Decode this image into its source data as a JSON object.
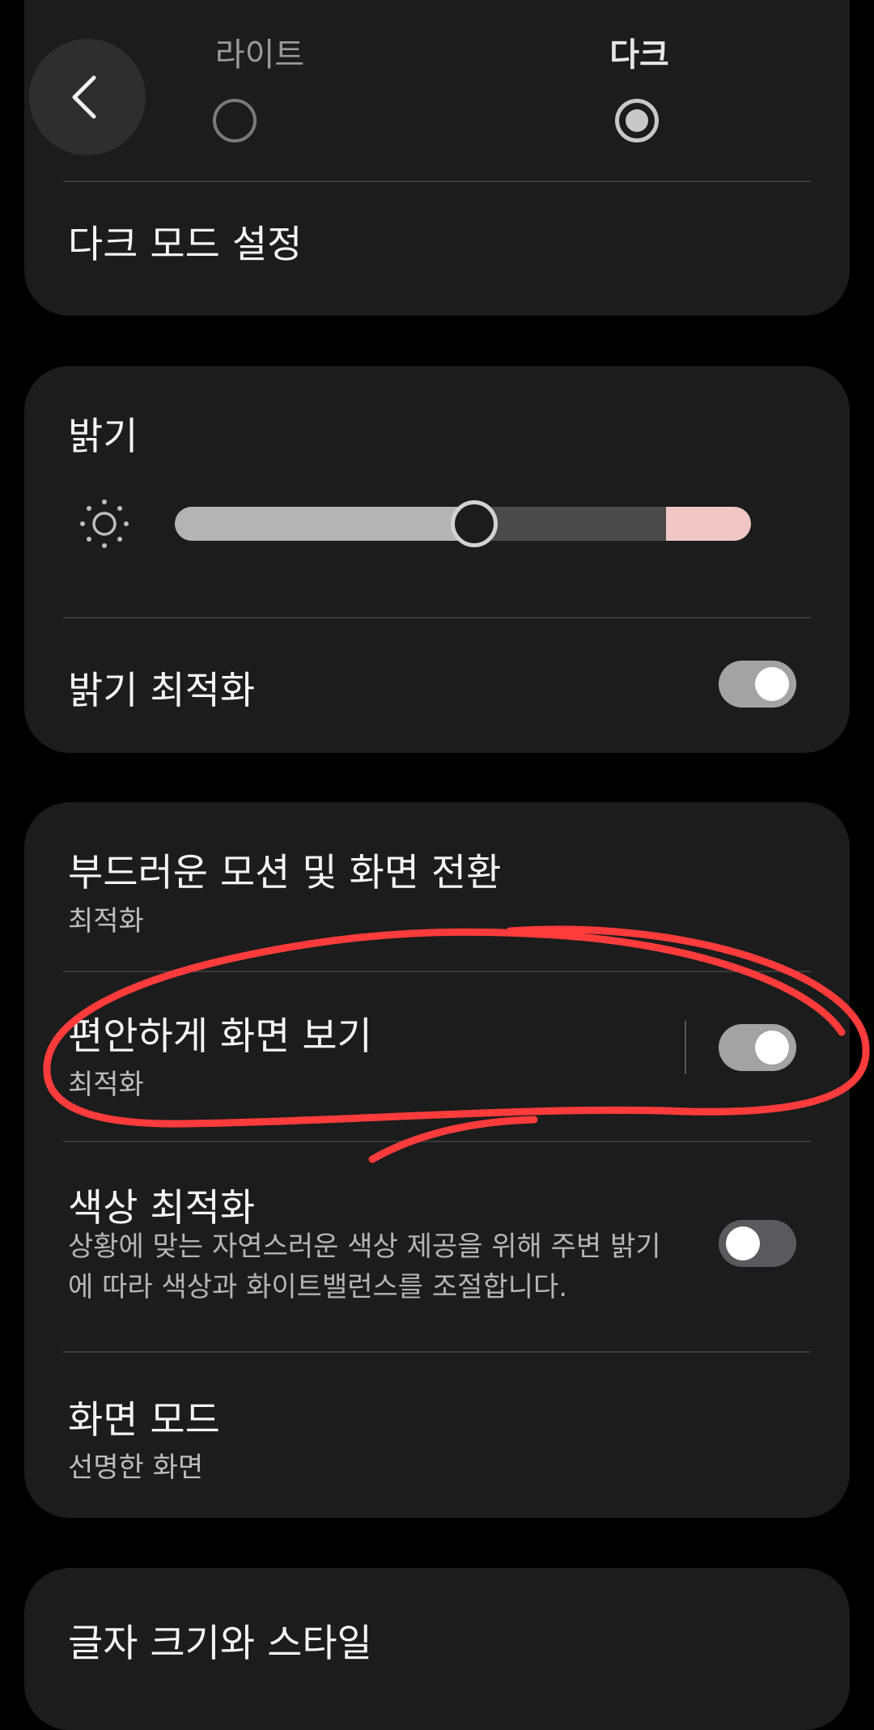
{
  "theme": {
    "light_label": "라이트",
    "dark_label": "다크",
    "selected": "dark",
    "dark_mode_settings": "다크 모드 설정"
  },
  "brightness": {
    "title": "밝기",
    "level_fraction": 0.52,
    "extra_bright_start_fraction": 0.853,
    "adaptive_label": "밝기 최적화",
    "adaptive_on": true
  },
  "screen": {
    "motion": {
      "title": "부드러운 모션 및 화면 전환",
      "value": "최적화"
    },
    "eye_comfort": {
      "title": "편안하게 화면 보기",
      "value": "최적화",
      "on": true
    },
    "color_opt": {
      "title": "색상 최적화",
      "description": "상황에 맞는 자연스러운 색상 제공을 위해 주변 밝기에 따라 색상과 화이트밸런스를 조절합니다.",
      "on": false
    },
    "screen_mode": {
      "title": "화면 모드",
      "value": "선명한 화면"
    }
  },
  "font": {
    "title": "글자 크기와 스타일"
  },
  "colors": {
    "background": "#000000",
    "card": "#1c1c1c",
    "annotation": "#ff3b3b",
    "extra_bright": "#f0c7c4"
  }
}
